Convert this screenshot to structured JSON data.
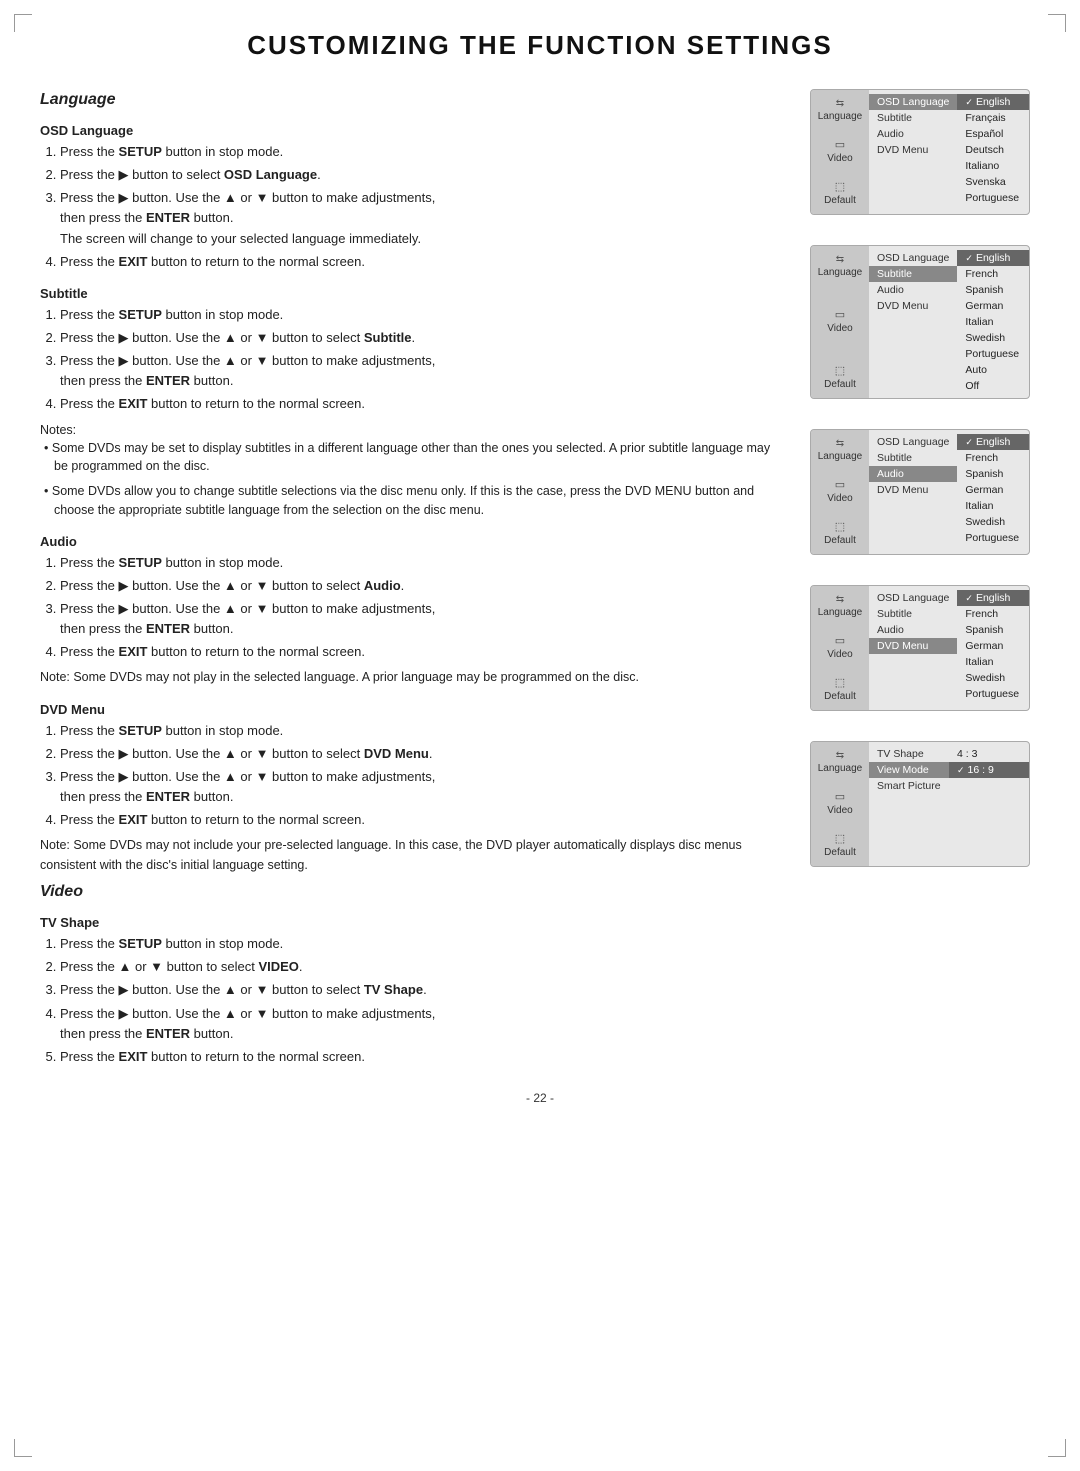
{
  "page": {
    "title": "CUSTOMIZING THE FUNCTION SETTINGS",
    "page_number": "- 22 -"
  },
  "language_section": {
    "heading": "Language",
    "osd_language": {
      "heading": "OSD Language",
      "steps": [
        "Press the <b>SETUP</b> button in stop mode.",
        "Press the ▶ button to select <b>OSD Language</b>.",
        "Press the ▶ button. Use the ▲ or ▼ button to make adjustments, then press the <b>ENTER</b> button.",
        "Press the <b>EXIT</b> button to return to the normal screen."
      ],
      "extra_text": "The screen will change to your selected language immediately."
    },
    "subtitle": {
      "heading": "Subtitle",
      "steps": [
        "Press the <b>SETUP</b> button in stop mode.",
        "Press the ▶ button. Use the ▲ or ▼ button to select <b>Subtitle</b>.",
        "Press the ▶ button. Use the ▲ or ▼ button to make adjustments, then press the <b>ENTER</b> button.",
        "Press the <b>EXIT</b> button to return to the normal screen."
      ],
      "notes_label": "Notes:",
      "notes": [
        "Some DVDs may be set to display subtitles in a different language other than the ones you selected. A prior subtitle language may be programmed on the disc.",
        "Some DVDs allow you to change subtitle selections via the disc menu only. If this is the case, press the DVD MENU button and choose the appropriate subtitle language from the selection on the disc menu."
      ]
    },
    "audio": {
      "heading": "Audio",
      "steps": [
        "Press the <b>SETUP</b> button in stop mode.",
        "Press the ▶ button. Use the ▲ or ▼ button to select <b>Audio</b>.",
        "Press the ▶ button. Use the ▲ or ▼ button to make adjustments, then press the <b>ENTER</b> button.",
        "Press the <b>EXIT</b> button to return to the normal screen."
      ],
      "note": "Note: Some DVDs may not play in the selected language. A prior language may be programmed on the disc."
    },
    "dvd_menu": {
      "heading": "DVD Menu",
      "steps": [
        "Press the <b>SETUP</b> button in stop mode.",
        "Press the ▶ button. Use the ▲ or ▼ button to select <b>DVD Menu</b>.",
        "Press the ▶ button. Use the ▲ or ▼ button to make adjustments, then press the <b>ENTER</b> button.",
        "Press the <b>EXIT</b> button to return to the normal screen."
      ],
      "note": "Note: Some DVDs may not include your pre-selected language. In this case, the DVD player automatically displays disc menus consistent with the disc's initial language setting."
    }
  },
  "video_section": {
    "heading": "Video",
    "tv_shape": {
      "heading": "TV Shape",
      "steps": [
        "Press the <b>SETUP</b> button in stop mode.",
        "Press the ▲ or ▼ button to select <b>VIDEO</b>.",
        "Press the ▶ button. Use the ▲ or ▼ button to select <b>TV Shape</b>.",
        "Press the ▶ button. Use the ▲ or ▼ button to make adjustments, then press the <b>ENTER</b> button.",
        "Press the <b>EXIT</b> button to return to the normal screen."
      ]
    }
  },
  "menus": {
    "osd_language": {
      "sidebar": {
        "top_label": "Language",
        "top_icon": "⇆",
        "mid_label": "Video",
        "mid_icon": "📺",
        "bot_label": "Default",
        "bot_icon": "⬚"
      },
      "col1": [
        "OSD Language",
        "Subtitle",
        "Audio",
        "DVD Menu"
      ],
      "col1_active": "OSD Language",
      "col2": [
        "English",
        "Français",
        "Español",
        "Deutsch",
        "Italiano",
        "Svenska",
        "Portuguese"
      ],
      "col2_selected": "English"
    },
    "subtitle": {
      "sidebar": {
        "top_label": "Language",
        "top_icon": "⇆",
        "mid_label": "Video",
        "mid_icon": "📺",
        "bot_label": "Default",
        "bot_icon": "⬚"
      },
      "col1": [
        "OSD Language",
        "Subtitle",
        "Audio",
        "DVD Menu"
      ],
      "col1_active": "Subtitle",
      "col2": [
        "English",
        "French",
        "Spanish",
        "German",
        "Italian",
        "Swedish",
        "Portuguese",
        "Auto",
        "Off"
      ],
      "col2_selected": "English"
    },
    "audio": {
      "sidebar": {
        "top_label": "Language",
        "top_icon": "⇆",
        "mid_label": "Video",
        "mid_icon": "📺",
        "bot_label": "Default",
        "bot_icon": "⬚"
      },
      "col1": [
        "OSD Language",
        "Subtitle",
        "Audio",
        "DVD Menu"
      ],
      "col1_active": "Audio",
      "col2": [
        "English",
        "French",
        "Spanish",
        "German",
        "Italian",
        "Swedish",
        "Portuguese"
      ],
      "col2_selected": "English"
    },
    "dvd_menu": {
      "sidebar": {
        "top_label": "Language",
        "top_icon": "⇆",
        "mid_label": "Video",
        "mid_icon": "📺",
        "bot_label": "Default",
        "bot_icon": "⬚"
      },
      "col1": [
        "OSD Language",
        "Subtitle",
        "Audio",
        "DVD Menu"
      ],
      "col1_active": "DVD Menu",
      "col2": [
        "English",
        "French",
        "Spanish",
        "German",
        "Italian",
        "Swedish",
        "Portuguese"
      ],
      "col2_selected": "English"
    },
    "video": {
      "sidebar": {
        "top_label": "Language",
        "top_icon": "⇆",
        "mid_label": "Video",
        "mid_icon": "📺",
        "bot_label": "Default",
        "bot_icon": "⬚"
      },
      "col1": [
        "TV Shape",
        "View Mode",
        "Smart Picture"
      ],
      "col1_active": "View Mode",
      "col2": [
        "4 : 3",
        "16 : 9"
      ],
      "col2_selected": "16 : 9"
    }
  }
}
